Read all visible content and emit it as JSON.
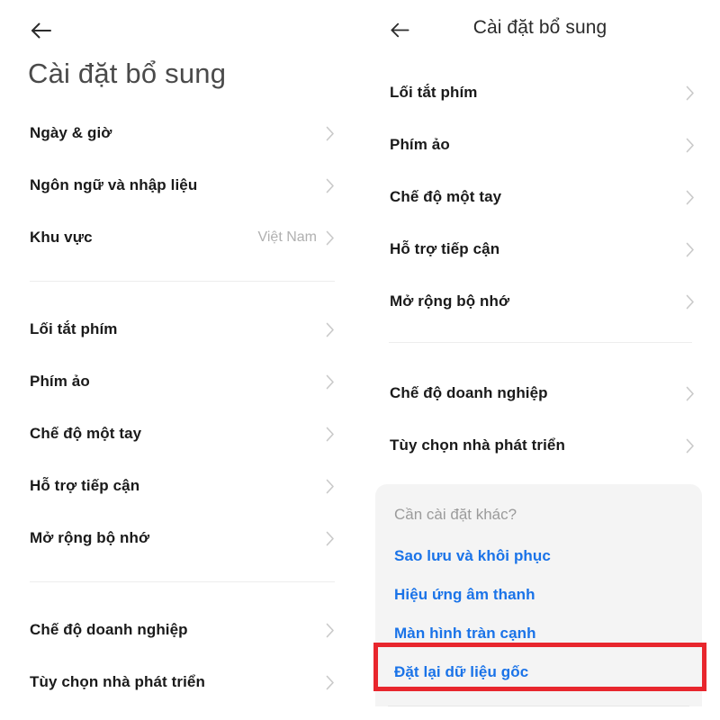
{
  "left_panel": {
    "back_icon": "arrow-left-icon",
    "title": "Cài đặt bổ sung",
    "groups": [
      {
        "items": [
          {
            "label": "Ngày & giờ",
            "value": "",
            "chevron": "chevron-right-icon"
          },
          {
            "label": "Ngôn ngữ và nhập liệu",
            "value": "",
            "chevron": "chevron-right-icon"
          },
          {
            "label": "Khu vực",
            "value": "Việt Nam",
            "chevron": "chevron-right-icon"
          }
        ]
      },
      {
        "items": [
          {
            "label": "Lối tắt phím",
            "value": "",
            "chevron": "chevron-right-icon"
          },
          {
            "label": "Phím ảo",
            "value": "",
            "chevron": "chevron-right-icon"
          },
          {
            "label": "Chế độ một tay",
            "value": "",
            "chevron": "chevron-right-icon"
          },
          {
            "label": "Hỗ trợ tiếp cận",
            "value": "",
            "chevron": "chevron-right-icon"
          },
          {
            "label": "Mở rộng bộ nhớ",
            "value": "",
            "chevron": "chevron-right-icon"
          }
        ]
      },
      {
        "items": [
          {
            "label": "Chế độ doanh nghiệp",
            "value": "",
            "chevron": "chevron-right-icon"
          },
          {
            "label": "Tùy chọn nhà phát triển",
            "value": "",
            "chevron": "chevron-right-icon"
          }
        ]
      }
    ]
  },
  "right_panel": {
    "back_icon": "arrow-left-icon",
    "title": "Cài đặt bổ sung",
    "groups": [
      {
        "items": [
          {
            "label": "Lối tắt phím",
            "value": "",
            "chevron": "chevron-right-icon"
          },
          {
            "label": "Phím ảo",
            "value": "",
            "chevron": "chevron-right-icon"
          },
          {
            "label": "Chế độ một tay",
            "value": "",
            "chevron": "chevron-right-icon"
          },
          {
            "label": "Hỗ trợ tiếp cận",
            "value": "",
            "chevron": "chevron-right-icon"
          },
          {
            "label": "Mở rộng bộ nhớ",
            "value": "",
            "chevron": "chevron-right-icon"
          }
        ]
      },
      {
        "items": [
          {
            "label": "Chế độ doanh nghiệp",
            "value": "",
            "chevron": "chevron-right-icon"
          },
          {
            "label": "Tùy chọn nhà phát triển",
            "value": "",
            "chevron": "chevron-right-icon"
          }
        ]
      }
    ],
    "card": {
      "title": "Cần cài đặt khác?",
      "links": [
        {
          "label": "Sao lưu và khôi phục"
        },
        {
          "label": "Hiệu ứng âm thanh"
        },
        {
          "label": "Màn hình tràn cạnh"
        },
        {
          "label": "Đặt lại dữ liệu gốc"
        }
      ]
    },
    "highlight": {
      "target_label": "Đặt lại dữ liệu gốc",
      "color": "#e8262d"
    }
  },
  "colors": {
    "background": "#ffffff",
    "primary_text": "#1a1a1a",
    "secondary_text": "#9b9b9b",
    "link": "#1a73e8",
    "divider": "#ededed",
    "card_background": "#f4f4f4",
    "highlight": "#e8262d"
  }
}
